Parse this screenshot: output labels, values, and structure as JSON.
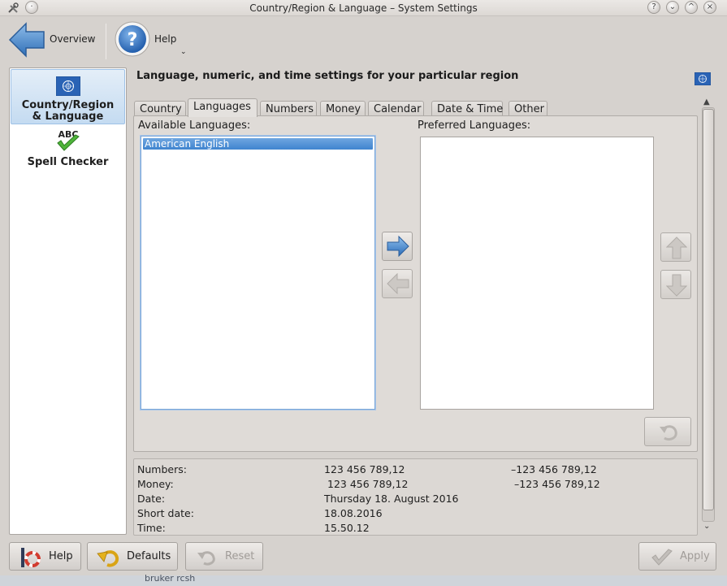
{
  "window": {
    "title": "Country/Region & Language – System Settings",
    "buttons": [
      "?",
      "⌄",
      "^",
      "×"
    ]
  },
  "toolbar": {
    "overview_label": "Overview",
    "help_label": "Help"
  },
  "sidebar": {
    "items": [
      {
        "label": "Country/Region & Language",
        "line1": "Country/Region",
        "line2": "& Language",
        "icon": "un-flag-icon",
        "selected": true
      },
      {
        "label": "Spell Checker",
        "icon": "abc-check-icon",
        "icon_text": "ABC",
        "selected": false
      }
    ]
  },
  "main": {
    "heading": "Language, numeric, and time settings for your particular region",
    "tabs": [
      {
        "label": "Country",
        "active": false
      },
      {
        "label": "Languages",
        "active": true
      },
      {
        "label": "Numbers",
        "active": false
      },
      {
        "label": "Money",
        "active": false
      },
      {
        "label": "Calendar",
        "active": false
      },
      {
        "label": "Date & Time",
        "active": false
      },
      {
        "label": "Other",
        "active": false
      }
    ],
    "available_label": "Available Languages:",
    "available_items": [
      "American English"
    ],
    "preferred_label": "Preferred Languages:",
    "preferred_items": []
  },
  "examples": [
    {
      "label": "Numbers:",
      "positive": "123 456 789,12",
      "negative": "–123 456 789,12"
    },
    {
      "label": "Money:",
      "positive": "123 456 789,12",
      "negative": "–123 456 789,12"
    },
    {
      "label": "Date:",
      "positive": "Thursday 18. August 2016"
    },
    {
      "label": "Short date:",
      "positive": "18.08.2016"
    },
    {
      "label": "Time:",
      "positive": "15.50.12"
    }
  ],
  "buttons": {
    "help": "Help",
    "defaults": "Defaults",
    "reset": "Reset",
    "apply": "Apply"
  },
  "behind_text": "bruker rcsh",
  "colors": {
    "accent": "#3f84cf",
    "selection": "#c4dbf1"
  }
}
